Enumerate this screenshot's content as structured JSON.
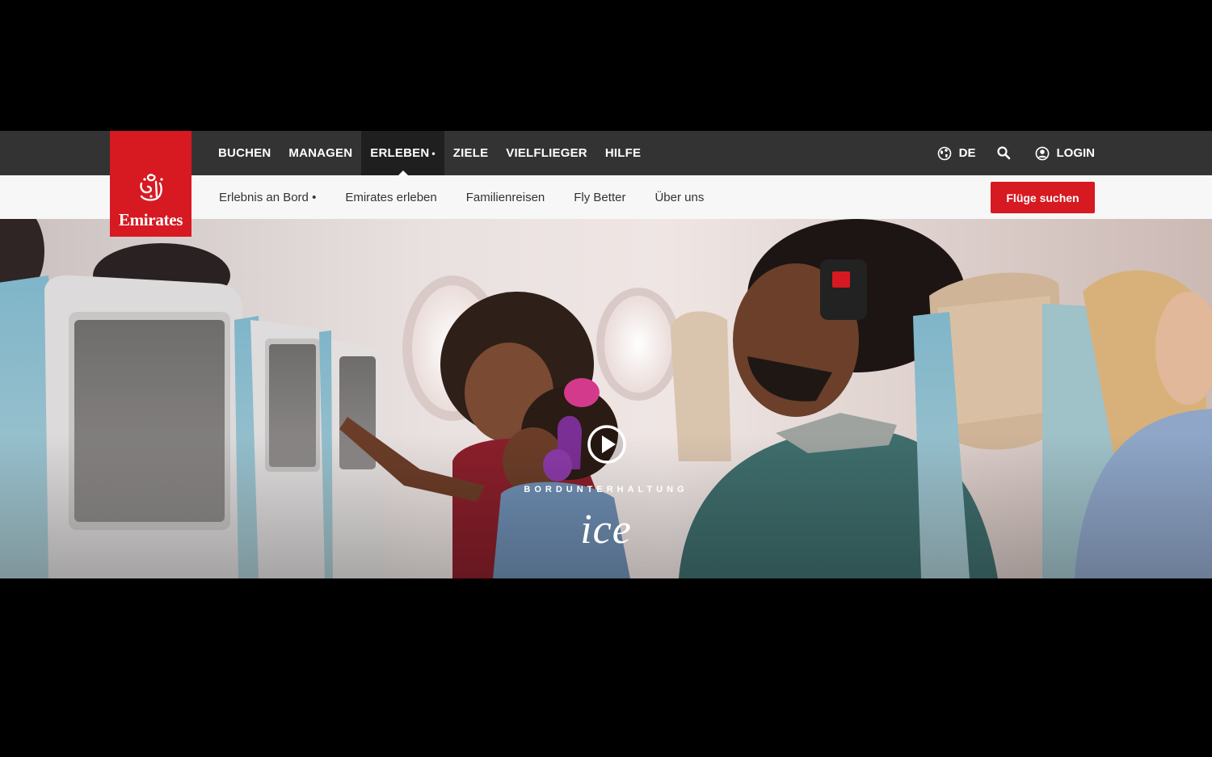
{
  "logo": {
    "wordmark": "Emirates"
  },
  "main_nav": {
    "items": [
      {
        "label": "BUCHEN"
      },
      {
        "label": "MANAGEN"
      },
      {
        "label": "ERLEBEN",
        "active": true
      },
      {
        "label": "ZIELE"
      },
      {
        "label": "VIELFLIEGER"
      },
      {
        "label": "HILFE"
      }
    ],
    "active_dot": "•"
  },
  "utility": {
    "language": "DE",
    "login": "LOGIN"
  },
  "sub_nav": {
    "items": [
      {
        "label": "Erlebnis an Bord •"
      },
      {
        "label": "Emirates erleben"
      },
      {
        "label": "Familienreisen"
      },
      {
        "label": "Fly Better"
      },
      {
        "label": "Über uns"
      }
    ],
    "cta_label": "Flüge suchen"
  },
  "hero": {
    "eyebrow": "BORDUNTERHALTUNG",
    "brand": "ice"
  },
  "colors": {
    "brand_red": "#d71921",
    "topbar": "#333333",
    "subbar": "#f7f7f7"
  }
}
